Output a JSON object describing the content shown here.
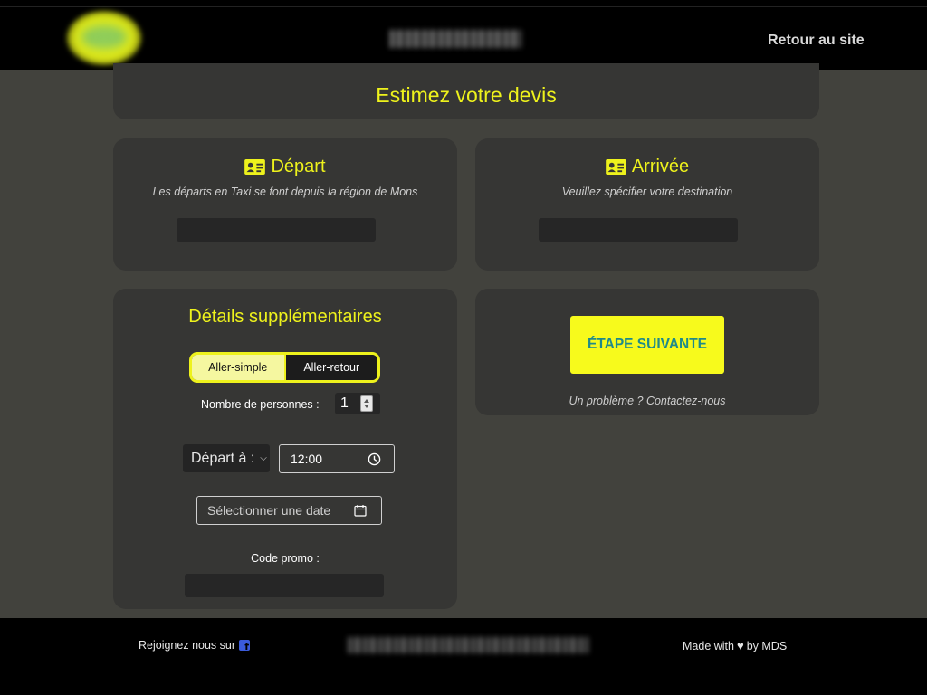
{
  "header": {
    "back_label": "Retour au site"
  },
  "title": "Estimez votre devis",
  "departure": {
    "heading": "Départ",
    "subtitle": "Les départs en Taxi se font depuis la région de Mons",
    "value": ""
  },
  "arrival": {
    "heading": "Arrivée",
    "subtitle": "Veuillez spécifier votre destination",
    "value": ""
  },
  "details": {
    "heading": "Détails supplémentaires",
    "trip_options": [
      "Aller-simple",
      "Aller-retour"
    ],
    "trip_selected": "Aller-simple",
    "persons_label": "Nombre de personnes :",
    "persons_value": "1",
    "depart_select": "Départ à :",
    "time_value": "12:00",
    "date_placeholder": "Sélectionner une date",
    "promo_label": "Code promo :",
    "promo_value": ""
  },
  "next": {
    "button_label": "ÉTAPE SUIVANTE",
    "contact_text": "Un problème ? Contactez-nous"
  },
  "footer": {
    "join_text": "Rejoignez nous sur",
    "made_with_prefix": "Made with",
    "made_with_suffix": "by MDS"
  },
  "colors": {
    "accent": "#eef21c",
    "background": "#42423d",
    "card": "#363634",
    "button_text": "#1f8a8a"
  },
  "icons": {
    "id_card": "id-card-icon",
    "clock": "clock-icon",
    "calendar": "calendar-icon",
    "facebook": "facebook-icon",
    "heart": "heart-icon"
  }
}
